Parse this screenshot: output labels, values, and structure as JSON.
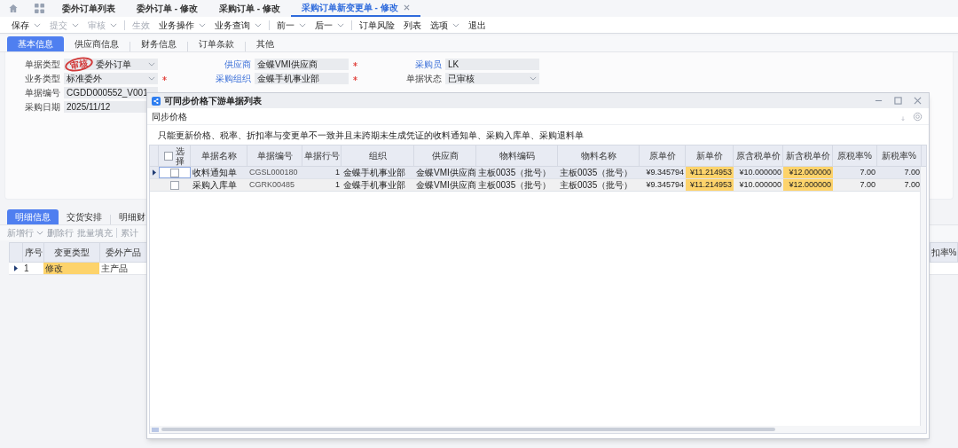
{
  "nav_tabs": [
    {
      "label": "委外订单列表",
      "selected": false
    },
    {
      "label": "委外订单 - 修改",
      "selected": false
    },
    {
      "label": "采购订单 - 修改",
      "selected": false
    },
    {
      "label": "采购订单新变更单 - 修改",
      "selected": true
    }
  ],
  "toolbar": [
    {
      "kind": "button",
      "label": "保存",
      "dropdown": true,
      "disabled": false
    },
    {
      "kind": "button",
      "label": "提交",
      "dropdown": true,
      "disabled": true
    },
    {
      "kind": "button",
      "label": "审核",
      "dropdown": true,
      "disabled": true
    },
    {
      "kind": "separator"
    },
    {
      "kind": "button",
      "label": "生效",
      "dropdown": false,
      "disabled": true
    },
    {
      "kind": "button",
      "label": "业务操作",
      "dropdown": true,
      "disabled": false
    },
    {
      "kind": "button",
      "label": "业务查询",
      "dropdown": true,
      "disabled": false
    },
    {
      "kind": "separator"
    },
    {
      "kind": "button",
      "label": "前一",
      "dropdown": true,
      "disabled": false
    },
    {
      "kind": "button",
      "label": "后一",
      "dropdown": true,
      "disabled": false
    },
    {
      "kind": "separator"
    },
    {
      "kind": "button",
      "label": "订单风险",
      "dropdown": false,
      "disabled": false
    },
    {
      "kind": "button",
      "label": "列表",
      "dropdown": false,
      "disabled": false
    },
    {
      "kind": "button",
      "label": "选项",
      "dropdown": true,
      "disabled": false
    },
    {
      "kind": "button",
      "label": "退出",
      "dropdown": false,
      "disabled": false
    }
  ],
  "form_tabs": [
    {
      "label": "基本信息",
      "selected": true
    },
    {
      "label": "供应商信息",
      "selected": false
    },
    {
      "label": "财务信息",
      "selected": false
    },
    {
      "label": "订单条款",
      "selected": false
    },
    {
      "label": "其他",
      "selected": false
    }
  ],
  "form": {
    "stamp": "审核",
    "columns": [
      [
        {
          "label": "单据类型",
          "value": "委外订单",
          "link": false,
          "dropdown": true,
          "required": false,
          "stamped": true
        },
        {
          "label": "业务类型",
          "value": "标准委外",
          "link": false,
          "dropdown": true,
          "required": true,
          "stamped": false
        },
        {
          "label": "单据编号",
          "value": "CGDD000552_V001",
          "link": false,
          "dropdown": false,
          "required": false,
          "stamped": false
        },
        {
          "label": "采购日期",
          "value": "2025/11/12",
          "link": false,
          "dropdown": false,
          "required": false,
          "stamped": false
        }
      ],
      [
        {
          "label": "供应商",
          "value": "金蝶VMI供应商",
          "link": true,
          "dropdown": false,
          "required": true,
          "stamped": false
        },
        {
          "label": "采购组织",
          "value": "金蝶手机事业部",
          "link": true,
          "dropdown": false,
          "required": true,
          "stamped": false
        }
      ],
      [
        {
          "label": "采购员",
          "value": "LK",
          "link": true,
          "dropdown": false,
          "required": false,
          "stamped": false
        },
        {
          "label": "单据状态",
          "value": "已审核",
          "link": false,
          "dropdown": true,
          "required": false,
          "stamped": false
        }
      ]
    ]
  },
  "detail_tabs": [
    {
      "label": "明细信息",
      "selected": true
    },
    {
      "label": "交货安排",
      "selected": false
    },
    {
      "label": "明细财",
      "selected": false
    }
  ],
  "detail_toolbar": [
    {
      "kind": "button",
      "label": "新增行",
      "dropdown": true
    },
    {
      "kind": "button",
      "label": "删除行",
      "dropdown": false
    },
    {
      "kind": "button",
      "label": "批量填充",
      "dropdown": false
    },
    {
      "kind": "separator"
    },
    {
      "kind": "button",
      "label": "累计",
      "dropdown": false
    }
  ],
  "detail_grid": {
    "columns": [
      "序号",
      "变更类型",
      "委外产品",
      "扣率%"
    ],
    "rows": [
      {
        "selected": true,
        "cells": [
          {
            "text": "1",
            "highlight": false
          },
          {
            "text": "修改",
            "highlight": true
          },
          {
            "text": "主产品",
            "highlight": false
          }
        ]
      }
    ]
  },
  "dialog": {
    "title": "可同步价格下游单据列表",
    "section": "同步价格",
    "note": "只能更新价格、税率、折扣率与变更单不一致并且未跨期未生成凭证的收料通知单、采购入库单、采购退料单",
    "select_all": {
      "label": "选择",
      "checked": false
    },
    "columns": [
      "单据名称",
      "单据编号",
      "单据行号",
      "组织",
      "供应商",
      "物料编码",
      "物料名称",
      "原单价",
      "新单价",
      "原含税单价",
      "新含税单价",
      "原税率%",
      "新税率%"
    ],
    "rows": [
      {
        "selected": true,
        "checked": false,
        "cells": [
          {
            "text": "收料通知单",
            "highlight": false
          },
          {
            "text": "CGSL000180",
            "highlight": false
          },
          {
            "text": "1",
            "highlight": false
          },
          {
            "text": "金蝶手机事业部",
            "highlight": false
          },
          {
            "text": "金蝶VMI供应商",
            "highlight": false
          },
          {
            "text": "主板0035（批号）",
            "highlight": false
          },
          {
            "text": "主板0035（批号）",
            "highlight": false
          },
          {
            "text": "¥9.345794",
            "highlight": false
          },
          {
            "text": "¥11.214953",
            "highlight": true
          },
          {
            "text": "¥10.000000",
            "highlight": false
          },
          {
            "text": "¥12.000000",
            "highlight": true
          },
          {
            "text": "7.00",
            "highlight": false
          },
          {
            "text": "7.00",
            "highlight": false
          }
        ]
      },
      {
        "selected": false,
        "checked": false,
        "cells": [
          {
            "text": "采购入库单",
            "highlight": false
          },
          {
            "text": "CGRK00485",
            "highlight": false
          },
          {
            "text": "1",
            "highlight": false
          },
          {
            "text": "金蝶手机事业部",
            "highlight": false
          },
          {
            "text": "金蝶VMI供应商",
            "highlight": false
          },
          {
            "text": "主板0035（批号）",
            "highlight": false
          },
          {
            "text": "主板0035（批号）",
            "highlight": false
          },
          {
            "text": "¥9.345794",
            "highlight": false
          },
          {
            "text": "¥11.214953",
            "highlight": true
          },
          {
            "text": "¥10.000000",
            "highlight": false
          },
          {
            "text": "¥12.000000",
            "highlight": true
          },
          {
            "text": "7.00",
            "highlight": false
          },
          {
            "text": "7.00",
            "highlight": false
          }
        ]
      }
    ]
  }
}
